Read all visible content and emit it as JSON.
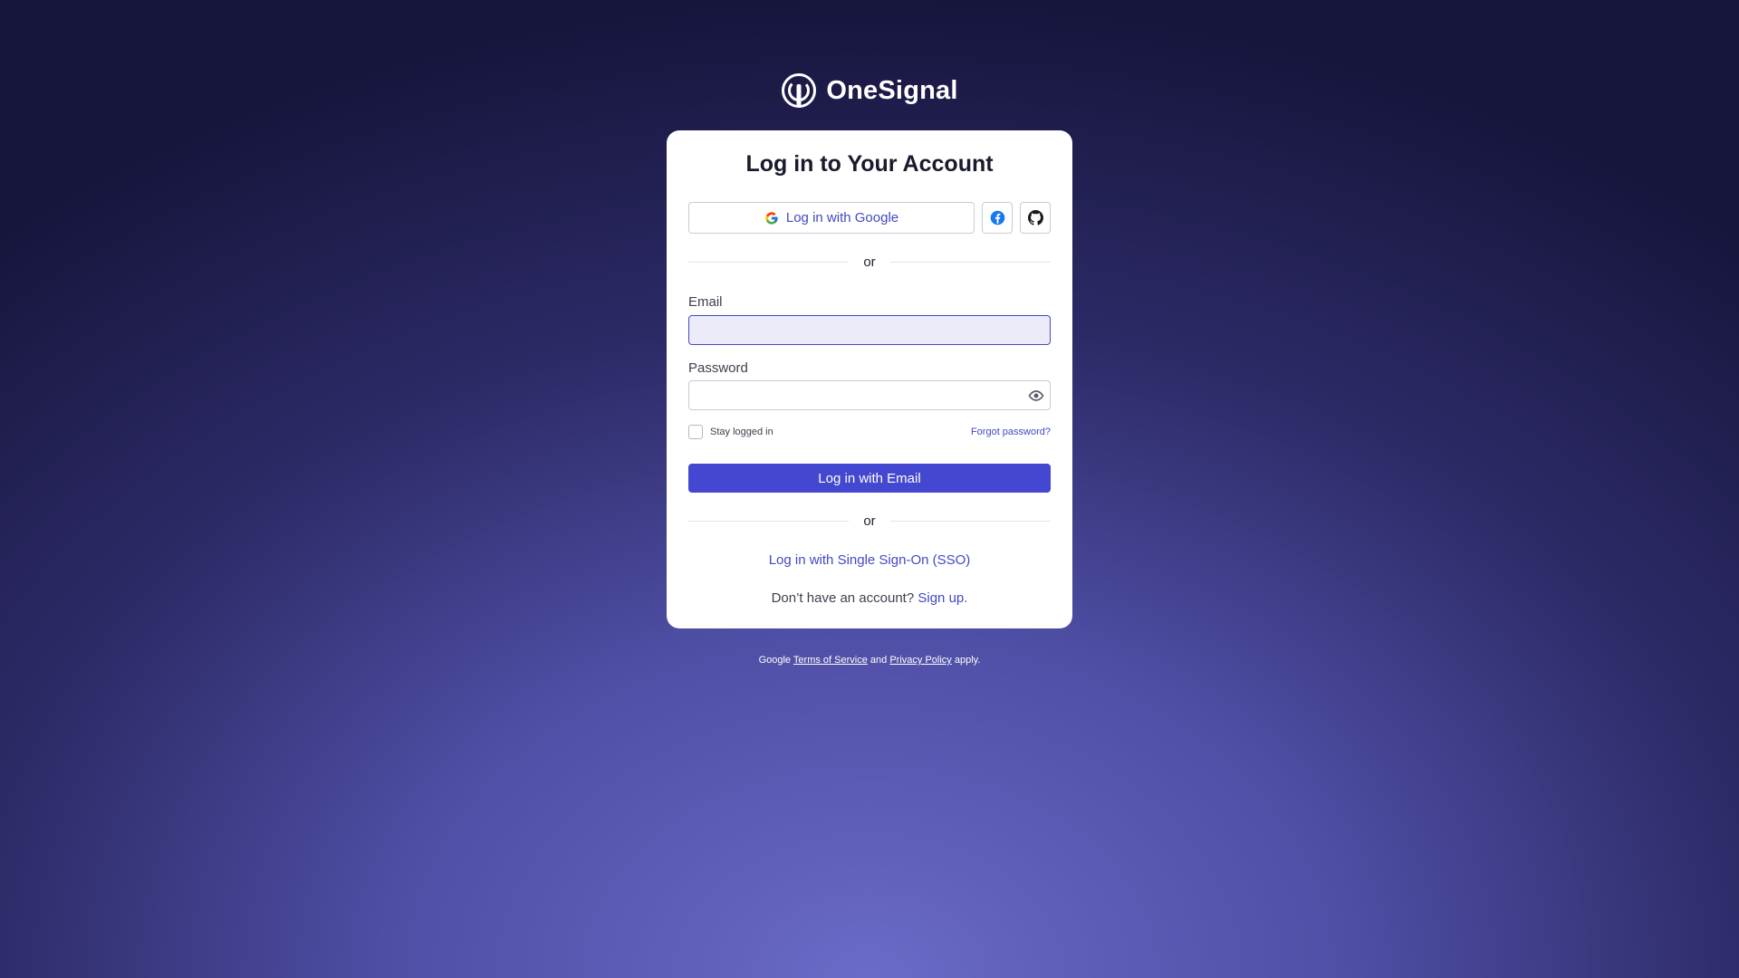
{
  "brand": {
    "name": "OneSignal",
    "logo_icon": "onesignal-logo-icon"
  },
  "card": {
    "title": "Log in to Your Account",
    "google_button_label": "Log in with Google",
    "divider_text": "or",
    "email_label": "Email",
    "email_value": "",
    "password_label": "Password",
    "password_value": "",
    "stay_logged_in_label": "Stay logged in",
    "forgot_password_label": "Forgot password?",
    "email_login_button_label": "Log in with Email",
    "sso_link_label": "Log in with Single Sign-On (SSO)",
    "signup_prompt": "Don’t have an account?",
    "signup_link_label": "Sign up."
  },
  "footer": {
    "prefix": "Google",
    "terms_label": "Terms of Service",
    "and_text": "and",
    "privacy_label": "Privacy Policy",
    "suffix": "apply."
  },
  "colors": {
    "accent": "#4447cf",
    "link": "#4248c6",
    "facebook": "#1877f2",
    "background_top": "#15143a",
    "background_bottom": "#6a6ac8"
  },
  "icons": {
    "google": "google-icon",
    "facebook": "facebook-icon",
    "github": "github-icon",
    "password_toggle": "eye-icon"
  }
}
